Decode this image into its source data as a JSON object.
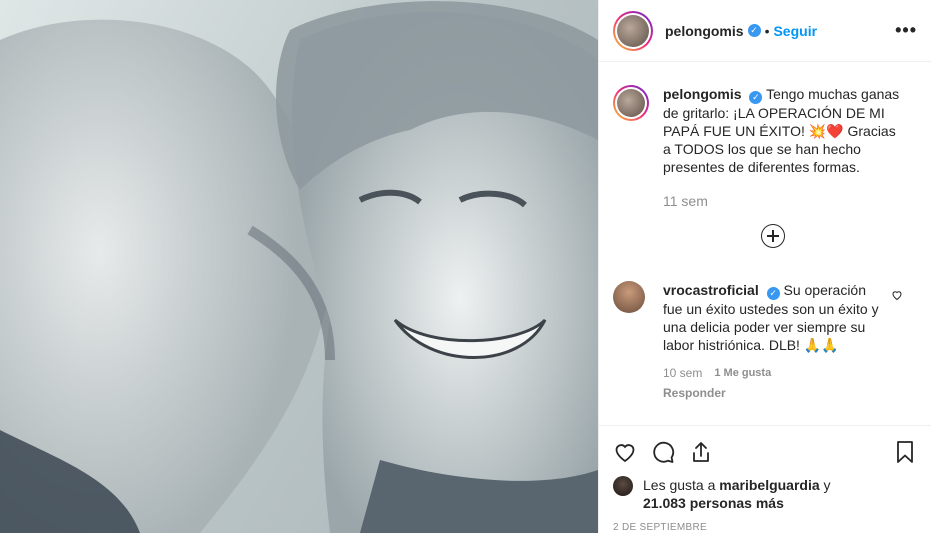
{
  "post": {
    "username": "pelongomis",
    "verified_badge": "verified-icon",
    "follow_label": "Seguir",
    "more_label": "•••"
  },
  "caption": {
    "username": "pelongomis",
    "text": "Tengo muchas ganas de gritarlo:  ¡LA OPERACIÓN DE MI PAPÁ FUE UN ÉXITO! 💥❤️ Gracias a TODOS los que se han hecho presentes de diferentes formas.",
    "time": "11 sem"
  },
  "comments": [
    {
      "username": "vrocastroficial",
      "text": "Su operación fue un éxito ustedes son un éxito y una delicia poder ver siempre su labor histriónica. DLB! 🙏🙏",
      "time": "10 sem",
      "likes": "1 Me gusta",
      "reply_label": "Responder"
    }
  ],
  "peek": {
    "hearts": "❤❤❤❤"
  },
  "likes": {
    "prefix": "Les gusta a",
    "user": "maribelguardia",
    "conjunction": "y",
    "others": "21.083 personas más"
  },
  "date": "2 DE SEPTIEMBRE",
  "icons": {
    "like": "heart-icon",
    "comment": "comment-icon",
    "share": "share-icon",
    "save": "bookmark-icon",
    "add": "plus-circle-icon"
  }
}
